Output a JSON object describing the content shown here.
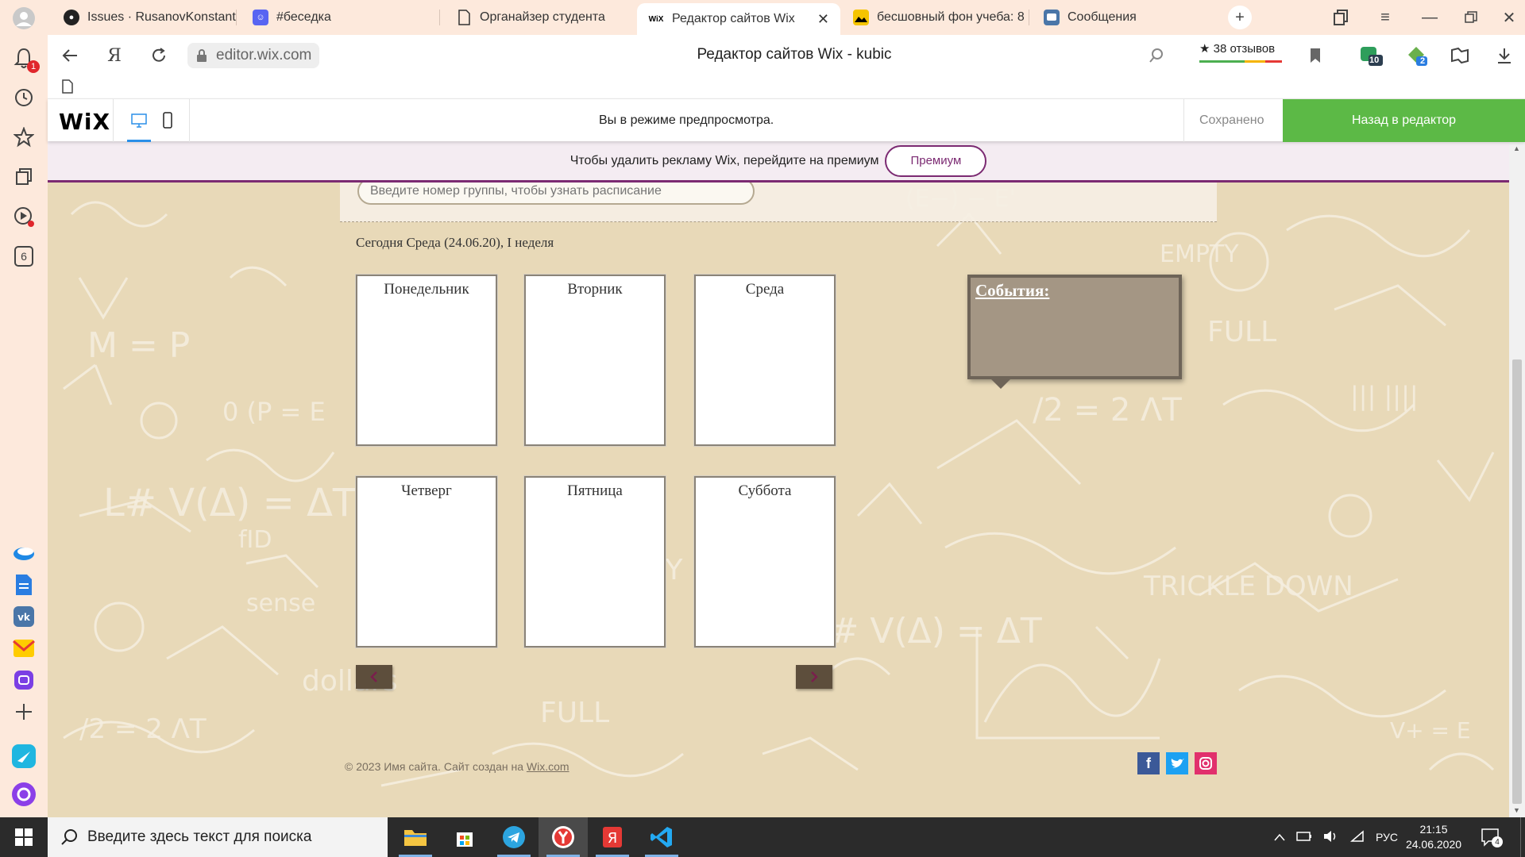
{
  "browser": {
    "tabs": [
      {
        "label": "Issues · RusanovKonstanti",
        "icon": "github-icon"
      },
      {
        "label": "#беседка",
        "icon": "discord-icon"
      },
      {
        "label": "Органайзер студента",
        "icon": "document-icon"
      },
      {
        "label": "Редактор сайтов Wix",
        "icon": "wix-icon",
        "active": true
      },
      {
        "label": "бесшовный фон учеба: 8",
        "icon": "image-icon"
      },
      {
        "label": "Сообщения",
        "icon": "vk-messages-icon"
      }
    ],
    "wix_favicon_text": "WiX",
    "url": "editor.wix.com",
    "page_title": "Редактор сайтов Wix - kubic",
    "reviews_label": "★ 38 отзывов",
    "notification_badge": "1",
    "sidebar_counter": "6",
    "ext_badge_1": "10",
    "ext_badge_2": "2"
  },
  "wix_bar": {
    "logo": "WiX",
    "preview_message": "Вы в режиме предпросмотра.",
    "saved_label": "Сохранено",
    "back_button": "Назад в редактор"
  },
  "ad_banner": {
    "text": "Чтобы удалить рекламу Wix, перейдите на премиум",
    "premium_button": "Премиум"
  },
  "site": {
    "group_input_placeholder": "Введите номер группы, чтобы узнать расписание",
    "today_text": "Сегодня Среда (24.06.20), I неделя",
    "days": [
      "Понедельник",
      "Вторник",
      "Среда",
      "Четверг",
      "Пятница",
      "Суббота"
    ],
    "events_title": "События:",
    "copyright_text": "© 2023 Имя сайта. Сайт создан на ",
    "copyright_link": "Wix.com",
    "social": [
      "facebook-icon",
      "twitter-icon",
      "instagram-icon"
    ]
  },
  "colors": {
    "wix_green": "#5cb946",
    "premium_purple": "#7b2a72",
    "site_bg": "#e8d9b8",
    "nav_button": "#5d4e3c"
  },
  "taskbar": {
    "search_placeholder": "Введите здесь текст для поиска",
    "language": "РУС",
    "time": "21:15",
    "date": "24.06.2020",
    "notification_count": "4"
  }
}
